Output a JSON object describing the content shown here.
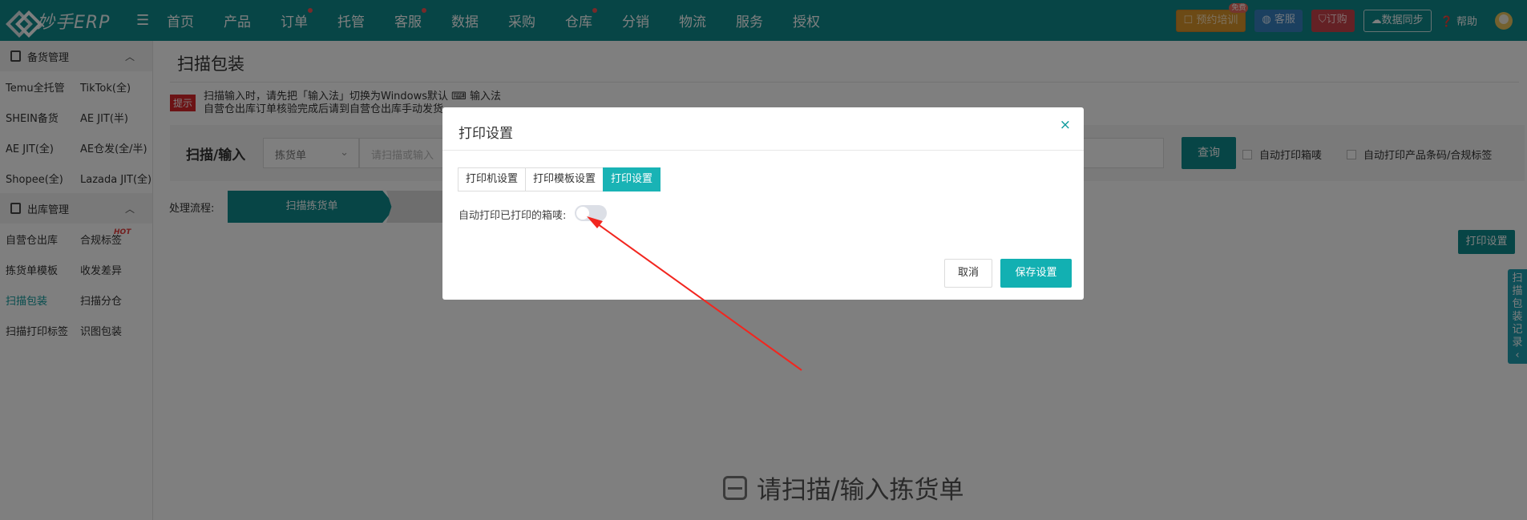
{
  "logo": {
    "text": "妙手ERP"
  },
  "nav": [
    {
      "label": "首页",
      "dot": false
    },
    {
      "label": "产品",
      "dot": false
    },
    {
      "label": "订单",
      "dot": true
    },
    {
      "label": "托管",
      "dot": false
    },
    {
      "label": "客服",
      "dot": true
    },
    {
      "label": "数据",
      "dot": false
    },
    {
      "label": "采购",
      "dot": false
    },
    {
      "label": "仓库",
      "dot": true
    },
    {
      "label": "分销",
      "dot": false
    },
    {
      "label": "物流",
      "dot": false
    },
    {
      "label": "服务",
      "dot": false
    },
    {
      "label": "授权",
      "dot": false
    }
  ],
  "top_right": {
    "training": "预约培训",
    "training_badge": "免费",
    "service": "客服",
    "order": "订购",
    "sync": "数据同步",
    "help": "帮助"
  },
  "sidebar": {
    "group1": "备货管理",
    "group1_rows": [
      [
        "Temu全托管",
        "TikTok(全)"
      ],
      [
        "SHEIN备货",
        "AE JIT(半)"
      ],
      [
        "AE JIT(全)",
        "AE仓发(全/半)"
      ],
      [
        "Shopee(全)",
        "Lazada JIT(全)"
      ]
    ],
    "group2": "出库管理",
    "group2_rows": [
      [
        "自营仓出库",
        "合规标签"
      ],
      [
        "拣货单模板",
        "收发差异"
      ],
      [
        "扫描包装",
        "扫描分仓"
      ],
      [
        "扫描打印标签",
        "识图包装"
      ]
    ],
    "hot_label": "HOT",
    "active_item": "扫描包装"
  },
  "main": {
    "title": "扫描包装",
    "tip_badge": "提示",
    "tip_line1": "扫描输入时，请先把「输入法」切换为Windows默认 ⌨ 输入法",
    "tip_line2": "自营仓出库订单核验完成后请到自营仓出库手动发货",
    "scan_label": "扫描/输入",
    "scan_select": "拣货单",
    "scan_placeholder": "请扫描或输入",
    "query": "查询",
    "chk_auto_box": "自动打印箱唛",
    "chk_auto_barcode": "自动打印产品条码/合规标签",
    "flow_label": "处理流程:",
    "flow_step1": "扫描拣货单",
    "print_settings_btn": "打印设置",
    "empty_hint": "请扫描/输入拣货单",
    "side_tab": "扫描包装记录"
  },
  "modal": {
    "title": "打印设置",
    "close": "×",
    "tabs": [
      "打印机设置",
      "打印模板设置",
      "打印设置"
    ],
    "active_tab": 2,
    "option_label": "自动打印已打印的箱唛:",
    "toggle_on": false,
    "cancel": "取消",
    "save": "保存设置"
  }
}
